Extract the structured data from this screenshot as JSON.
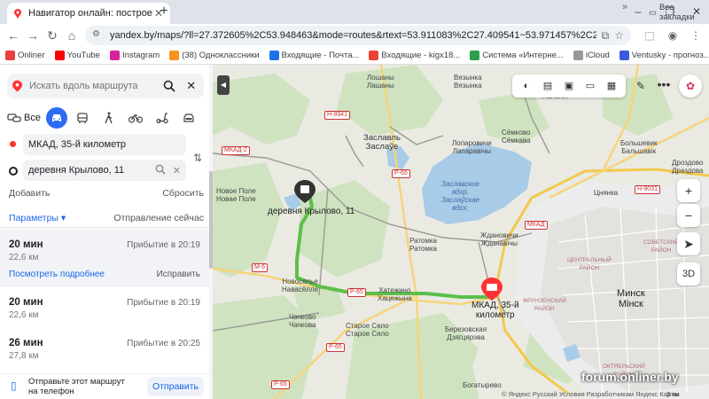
{
  "browser": {
    "tab_title": "Навигатор онлайн: построение",
    "url": "yandex.by/maps/?ll=27.372605%2C53.948463&mode=routes&rtext=53.911083%2C27.409541~53.971457%2C27.204650&rtt=auto&ruri=~...",
    "bookmarks": [
      {
        "label": "Onliner",
        "color": "#e8423f"
      },
      {
        "label": "YouTube",
        "color": "#ff0000"
      },
      {
        "label": "Instagram",
        "color": "#d6249f"
      },
      {
        "label": "(38) Одноклассники",
        "color": "#f7931e"
      },
      {
        "label": "Входящие - Почта...",
        "color": "#1a73e8"
      },
      {
        "label": "Входящие - kigx18...",
        "color": "#ea4335"
      },
      {
        "label": "Система «Интерне...",
        "color": "#2e9e4f"
      },
      {
        "label": "iCloud",
        "color": "#999999"
      },
      {
        "label": "Ventusky - прогноз...",
        "color": "#3b5bdb"
      }
    ],
    "bookmarks_more": "»",
    "all_bookmarks": "Все закладки"
  },
  "panel": {
    "search_placeholder": "Искать вдоль маршрута",
    "modes": {
      "all_label": "Все"
    },
    "from": "МКАД, 35-й километр",
    "to": "деревня Крылово, 11",
    "add": "Добавить",
    "reset": "Сбросить",
    "params": "Параметры ▾",
    "depart": "Отправление сейчас",
    "routes": [
      {
        "time": "20 мин",
        "arrival": "Прибытие в 20:19",
        "distance": "22,6 км",
        "details": "Посмотреть подробнее",
        "fix": "Исправить"
      },
      {
        "time": "20 мин",
        "arrival": "Прибытие в 20:19",
        "distance": "22,6 км"
      },
      {
        "time": "26 мин",
        "arrival": "Прибытие в 20:25",
        "distance": "27,8 км"
      }
    ],
    "send_text": "Отправьте этот маршрут на телефон",
    "send_button": "Отправить"
  },
  "map": {
    "labels": {
      "loshany": "Лошаны\nЛашаны",
      "vyazynka": "Вязынка\nВязынка",
      "poloniya": "Полония\nПалонія",
      "zaslavl": "Заславль\nЗаслаўе",
      "semkovo": "Сёмково\nСёмкава",
      "lapopavchi": "Лопаровичи\nЛапаравічы",
      "bolshevik": "Большевик\nБальшавік",
      "drozdovo": "Дроздово\nДраздова",
      "novoe_pole": "Новое Поле\nНовае Поле",
      "reservoir": "Заславское\nвдхр.\nЗаслаўскае\nвдсх.",
      "tsnyanka": "Цнянка",
      "ratomka": "Ратомка\nРатомка",
      "zhdanovichi": "Ждановичи\nЖданавічы",
      "novoselye": "Новоселье\nНавасёлле",
      "khatezhino": "Хатежино\nХацежына",
      "chachkovo": "Чачково\nЧачкова",
      "staroe_selo": "Старое Село\nСтарое Сяло",
      "berezhkovskaya": "Березовская\nДзягцярэва",
      "bogatyrevo": "Богатырево",
      "minsk": "Минск\nМінск",
      "sovetsky": "СОВЕТСКИЙ\nРАЙОН",
      "tsentralny": "ЦЕНТРАЛЬНЫЙ\nРАЙОН",
      "frunzensky": "ФРУНЗЕНСКИЙ\nРАЙОН",
      "oktyabrsky": "ОКТЯБРЬСКИЙ\nРАЙОН"
    },
    "place_label": "деревня Крылово, 11",
    "mkad_label": "МКАД, 35-й\nкилометр",
    "shields": [
      "Н-8941",
      "Р-65",
      "Р-65",
      "Р-65",
      "Н-9031",
      "М-6",
      "МКАД",
      "МКАД-2",
      "Р-65"
    ],
    "copyright": "© Яндекс   Русский   Условия   Разработчикам   Яндекс Карты",
    "watermark": "forum.onliner.by",
    "scale": "3 км",
    "zoom_3d": "3D"
  }
}
